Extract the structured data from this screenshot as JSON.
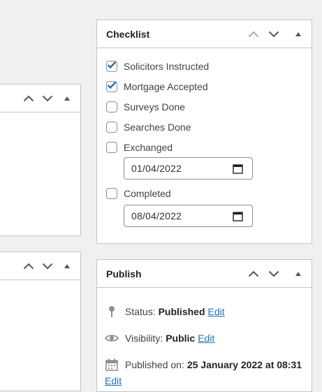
{
  "checklist": {
    "title": "Checklist",
    "items": [
      {
        "label": "Solicitors Instructed",
        "checked": true
      },
      {
        "label": "Mortgage Accepted",
        "checked": true
      },
      {
        "label": "Surveys Done",
        "checked": false
      },
      {
        "label": "Searches Done",
        "checked": false
      },
      {
        "label": "Exchanged",
        "checked": false,
        "date": "01/04/2022"
      },
      {
        "label": "Completed",
        "checked": false,
        "date": "08/04/2022"
      }
    ]
  },
  "publish": {
    "title": "Publish",
    "status_label": "Status:",
    "status_value": "Published",
    "visibility_label": "Visibility:",
    "visibility_value": "Public",
    "published_on_label": "Published on:",
    "published_on_value": "25 January 2022 at 08:31",
    "edit_label": "Edit"
  },
  "colors": {
    "background": "#f0f0f1",
    "panel_border": "#c3c4c7",
    "checkbox_check": "#2271b1",
    "link": "#2271b1",
    "icon_gray": "#8c8f94"
  }
}
